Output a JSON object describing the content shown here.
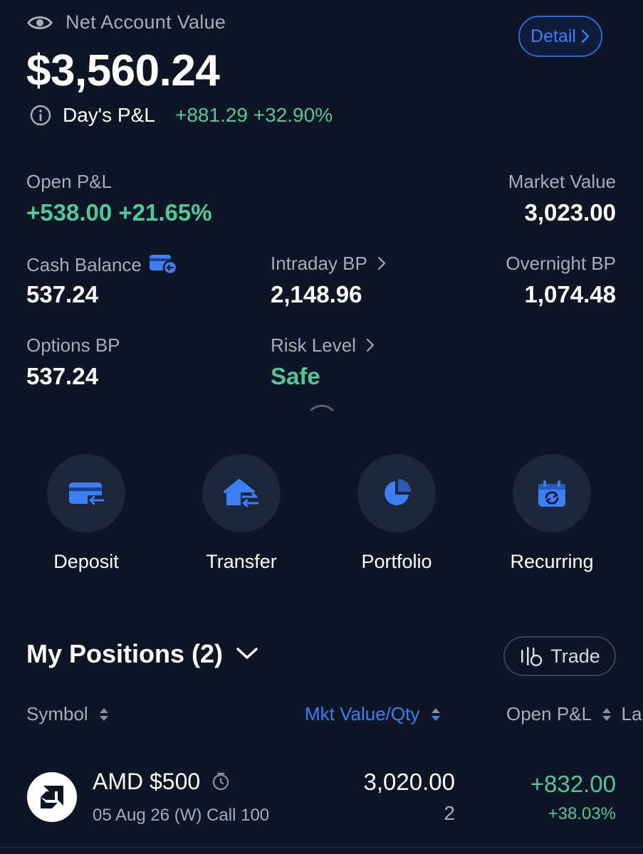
{
  "header": {
    "net_account_label": "Net Account Value",
    "net_account_value": "$3,560.24",
    "detail_button": "Detail",
    "days_pl_label": "Day's P&L",
    "days_pl_value": "+881.29 +32.90%"
  },
  "metrics": {
    "open_pl": {
      "label": "Open P&L",
      "value": "+538.00 +21.65%"
    },
    "market_value": {
      "label": "Market Value",
      "value": "3,023.00"
    },
    "cash_balance": {
      "label": "Cash Balance",
      "value": "537.24"
    },
    "intraday_bp": {
      "label": "Intraday BP",
      "value": "2,148.96"
    },
    "overnight_bp": {
      "label": "Overnight BP",
      "value": "1,074.48"
    },
    "options_bp": {
      "label": "Options BP",
      "value": "537.24"
    },
    "risk_level": {
      "label": "Risk Level",
      "value": "Safe"
    }
  },
  "quick_actions": [
    {
      "label": "Deposit",
      "icon": "deposit-card-icon"
    },
    {
      "label": "Transfer",
      "icon": "transfer-house-icon"
    },
    {
      "label": "Portfolio",
      "icon": "pie-chart-icon"
    },
    {
      "label": "Recurring",
      "icon": "recurring-calendar-icon"
    }
  ],
  "positions": {
    "title": "My Positions (2)",
    "trade_button": "Trade",
    "columns": {
      "symbol": "Symbol",
      "mkt_value_qty": "Mkt Value/Qty",
      "open_pl": "Open P&L",
      "last_partial": "La"
    },
    "rows": [
      {
        "name": "AMD $500",
        "detail": "05 Aug 26 (W) Call 100",
        "mkt_value": "3,020.00",
        "qty": "2",
        "open_pl": "+832.00",
        "open_pl_pct": "+38.03%"
      }
    ]
  },
  "colors": {
    "background": "#0e1525",
    "accent_blue": "#3d7ff5",
    "gain_green": "#4fc99a",
    "muted_text": "#a7adb9"
  }
}
